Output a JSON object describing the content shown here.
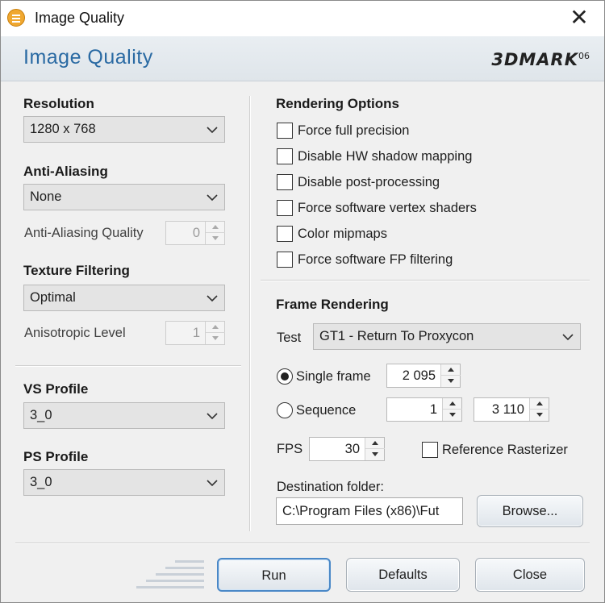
{
  "window": {
    "title": "Image Quality",
    "close_glyph": "✕"
  },
  "header": {
    "title": "Image Quality",
    "logo_text": "3DMARK",
    "logo_suffix": "06"
  },
  "left": {
    "resolution": {
      "label": "Resolution",
      "value": "1280 x 768"
    },
    "anti_aliasing": {
      "label": "Anti-Aliasing",
      "value": "None"
    },
    "aa_quality": {
      "label": "Anti-Aliasing Quality",
      "value": "0"
    },
    "texture_filtering": {
      "label": "Texture Filtering",
      "value": "Optimal"
    },
    "anisotropic": {
      "label": "Anisotropic Level",
      "value": "1"
    },
    "vs_profile": {
      "label": "VS Profile",
      "value": "3_0"
    },
    "ps_profile": {
      "label": "PS Profile",
      "value": "3_0"
    }
  },
  "rendering_options": {
    "title": "Rendering Options",
    "items": [
      {
        "label": "Force full precision",
        "checked": false
      },
      {
        "label": "Disable HW shadow mapping",
        "checked": false
      },
      {
        "label": "Disable post-processing",
        "checked": false
      },
      {
        "label": "Force software vertex shaders",
        "checked": false
      },
      {
        "label": "Color mipmaps",
        "checked": false
      },
      {
        "label": "Force software FP filtering",
        "checked": false
      }
    ]
  },
  "frame_rendering": {
    "title": "Frame Rendering",
    "test_label": "Test",
    "test_value": "GT1 - Return To Proxycon",
    "single_frame_label": "Single frame",
    "single_frame_value": "2 095",
    "single_frame_selected": true,
    "sequence_label": "Sequence",
    "sequence_start": "1",
    "sequence_end": "3 110",
    "fps_label": "FPS",
    "fps_value": "30",
    "reference_rasterizer_label": "Reference Rasterizer",
    "reference_rasterizer_checked": false,
    "destination_label": "Destination folder:",
    "destination_value": "C:\\Program Files (x86)\\Fut",
    "browse_label": "Browse..."
  },
  "footer": {
    "run_label": "Run",
    "defaults_label": "Defaults",
    "close_label": "Close"
  },
  "colors": {
    "accent": "#2a6aa3",
    "focus_border": "#4a88c7"
  }
}
